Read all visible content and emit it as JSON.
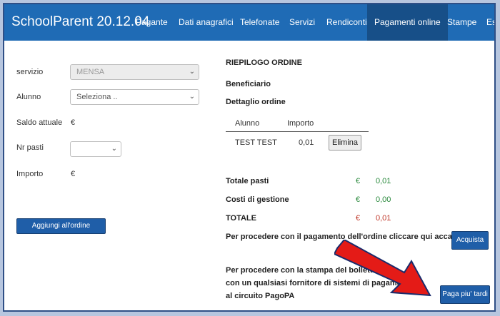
{
  "app": {
    "title": "SchoolParent 20.12.04"
  },
  "nav": {
    "items": [
      "Pagante",
      "Dati anagrafici",
      "Telefonate",
      "Servizi",
      "Rendiconti",
      "Pagamenti online",
      "Stampe",
      "Esci"
    ]
  },
  "form": {
    "servizio_label": "servizio",
    "servizio_value": "MENSA",
    "alunno_label": "Alunno",
    "alunno_value": "Seleziona ..",
    "saldo_label": "Saldo attuale",
    "saldo_value": "€",
    "pasti_label": "Nr pasti",
    "pasti_value": "",
    "importo_label": "Importo",
    "importo_value": "€",
    "add_button": "Aggiungi all'ordine"
  },
  "order": {
    "title": "RIEPILOGO ORDINE",
    "beneficiario": "Beneficiario",
    "dettaglio": "Dettaglio ordine",
    "col_alunno": "Alunno",
    "col_importo": "Importo",
    "rows": [
      {
        "alunno": "TEST TEST",
        "importo": "0,01",
        "action": "Elimina"
      }
    ],
    "totale_pasti_label": "Totale pasti",
    "totale_pasti_currency": "€",
    "totale_pasti_value": "0,01",
    "costi_label": "Costi di gestione",
    "costi_currency": "€",
    "costi_value": "0,00",
    "totale_label": "TOTALE",
    "totale_currency": "€",
    "totale_value": "0,01",
    "proceed_text": "Per procedere con il pagamento dell'ordine cliccare qui accanto",
    "buy_button": "Acquista",
    "print_line1": "Per procedere con la stampa del bollettino",
    "print_line2": "con un qualsiasi fornitore di sistemi di pagamento",
    "print_line3": "al circuito PagoPA",
    "pay_later_button": "Paga piu' tardi"
  },
  "colors": {
    "navbar": "#1f6bb5",
    "active_tab": "#174f88",
    "arrow": "#e41b17",
    "positive": "#2b8a3e",
    "total": "#c0392b"
  },
  "icons": {
    "arrow": "red-arrow-icon",
    "chevron": "chevron-down-icon"
  }
}
